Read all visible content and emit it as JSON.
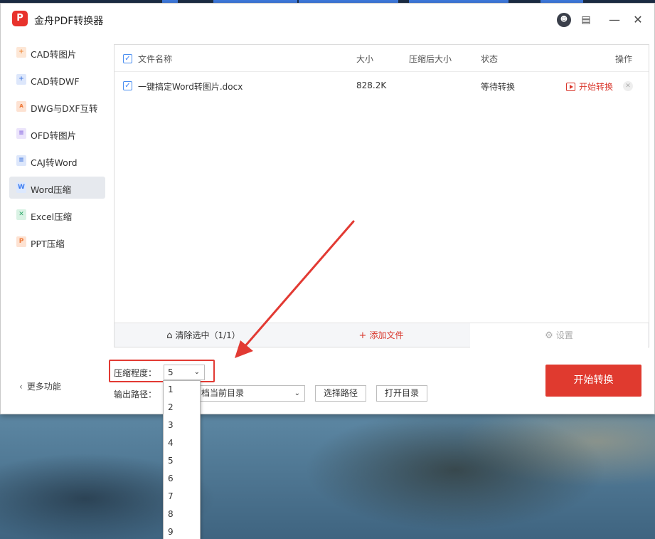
{
  "app": {
    "title": "金舟PDF转换器",
    "logo_text": "P"
  },
  "titlebar": {
    "icons": [
      "avatar-icon",
      "notes-icon",
      "minimize-icon",
      "close-icon"
    ]
  },
  "sidebar": {
    "items": [
      {
        "label": "CAD转图片",
        "icon": "cad-image-icon",
        "icon_glyph": "+",
        "color": "#f08a3c",
        "bg": "#fde7d6"
      },
      {
        "label": "CAD转DWF",
        "icon": "cad-dwf-icon",
        "icon_glyph": "+",
        "color": "#4a7de0",
        "bg": "#dde7fb"
      },
      {
        "label": "DWG与DXF互转",
        "icon": "dwg-dxf-icon",
        "icon_glyph": "ᴀ",
        "color": "#ef7a3a",
        "bg": "#fde2d2"
      },
      {
        "label": "OFD转图片",
        "icon": "ofd-image-icon",
        "icon_glyph": "≡",
        "color": "#8a6be0",
        "bg": "#ebe4fb"
      },
      {
        "label": "CAJ转Word",
        "icon": "caj-word-icon",
        "icon_glyph": "≡",
        "color": "#4a7de0",
        "bg": "#dde7fb"
      },
      {
        "label": "Word压缩",
        "icon": "word-compress-icon",
        "icon_glyph": "W",
        "color": "#3d7cf0",
        "bg": "#dce8fd"
      },
      {
        "label": "Excel压缩",
        "icon": "excel-compress-icon",
        "icon_glyph": "✕",
        "color": "#2fa96a",
        "bg": "#d9f2e4"
      },
      {
        "label": "PPT压缩",
        "icon": "ppt-compress-icon",
        "icon_glyph": "P",
        "color": "#ef7a3a",
        "bg": "#fde2d2"
      }
    ],
    "active_index": 5,
    "more_label": "更多功能"
  },
  "table": {
    "headers": {
      "name": "文件名称",
      "size": "大小",
      "compressed_size": "压缩后大小",
      "status": "状态",
      "action": "操作"
    },
    "rows": [
      {
        "name": "一键搞定Word转图片.docx",
        "size": "828.2K",
        "compressed_size": "",
        "status": "等待转换",
        "action": "开始转换"
      }
    ]
  },
  "panel_footer": {
    "clear": "清除选中（1/1）",
    "add": "添加文件",
    "settings": "设置"
  },
  "options": {
    "level_label": "压缩程度：",
    "level_value": "5",
    "level_options": [
      "1",
      "2",
      "3",
      "4",
      "5",
      "6",
      "7",
      "8",
      "9"
    ],
    "output_label": "输出路径：",
    "output_value": "档当前目录",
    "choose_path": "选择路径",
    "open_dir": "打开目录"
  },
  "start_button": "开始转换",
  "colors": {
    "accent_red": "#e03a2f",
    "check_blue": "#3b82f6",
    "annotation_red": "#e23a33"
  }
}
